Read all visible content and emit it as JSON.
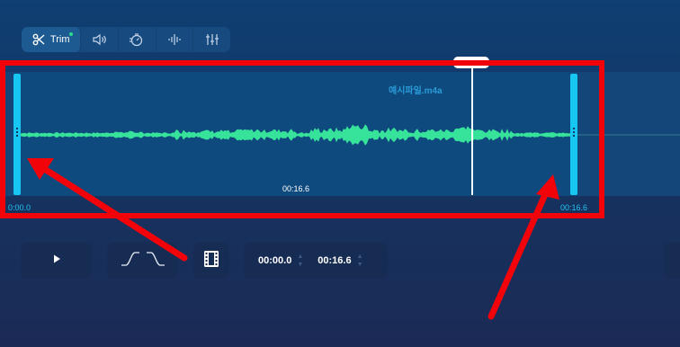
{
  "toolbar": {
    "trim_label": "Trim",
    "tools": [
      {
        "icon": "scissors-icon",
        "active": true
      },
      {
        "icon": "volume-icon"
      },
      {
        "icon": "speed-timer-icon"
      },
      {
        "icon": "waveform-icon"
      },
      {
        "icon": "equalizer-icon"
      }
    ]
  },
  "editor": {
    "filename": "예시파일.m4a",
    "midpoint_time": "00:16.6",
    "start_time": "0:00.0",
    "end_time": "00:16.6",
    "wave_color": "#37e39a",
    "handle_color": "#18c6f2"
  },
  "controls": {
    "trim_start": "00:00.0",
    "trim_end": "00:16.6",
    "step_up": "▲",
    "step_down": "▼"
  },
  "annotation": {
    "highlight_color": "#f2030a"
  }
}
